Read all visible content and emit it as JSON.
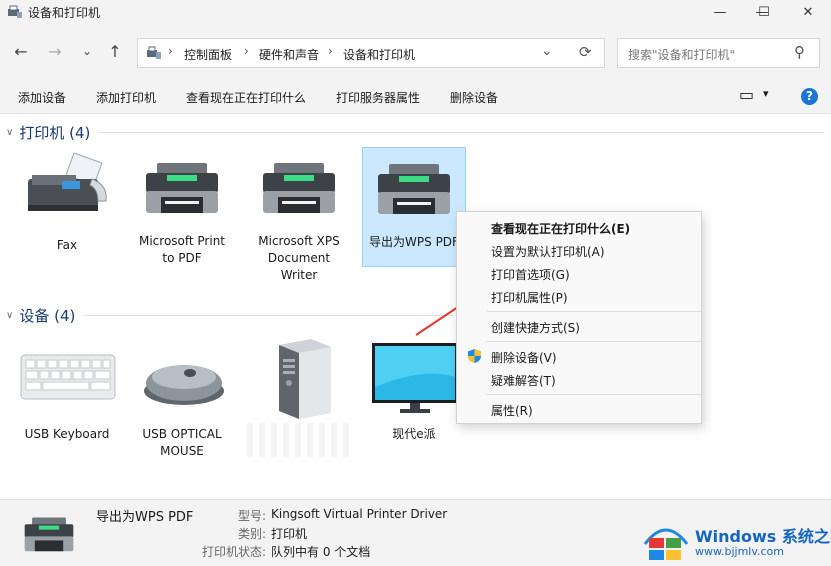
{
  "window": {
    "title": "设备和打印机",
    "minimize_glyph": "—",
    "maximize_glyph": "☐",
    "close_glyph": "✕"
  },
  "nav": {
    "back_glyph": "←",
    "forward_glyph": "→",
    "recent_glyph": "⌄",
    "up_glyph": "↑",
    "breadcrumb": [
      "控制面板",
      "硬件和声音",
      "设备和打印机"
    ],
    "separator_glyph": "›",
    "dropdown_glyph": "⌄",
    "refresh_glyph": "⟳",
    "search_placeholder": "搜索\"设备和打印机\"",
    "search_glyph": "⚲"
  },
  "toolbar": {
    "buttons": [
      "添加设备",
      "添加打印机",
      "查看现在正在打印什么",
      "打印服务器属性",
      "删除设备"
    ],
    "view_glyph": "▭",
    "view_dropdown_glyph": "▾",
    "help_glyph": "?"
  },
  "groups": {
    "printers": {
      "chevron_glyph": "∨",
      "title": "打印机 (4)",
      "items": [
        {
          "name": "Fax",
          "icon": "fax-icon"
        },
        {
          "name": "Microsoft Print to PDF",
          "icon": "printer-icon"
        },
        {
          "name": "Microsoft XPS Document Writer",
          "icon": "printer-icon"
        },
        {
          "name": "导出为WPS PDF",
          "icon": "printer-icon"
        }
      ]
    },
    "devices": {
      "chevron_glyph": "∨",
      "title": "设备 (4)",
      "items": [
        {
          "name": "USB Keyboard",
          "icon": "keyboard-icon"
        },
        {
          "name": "USB OPTICAL MOUSE",
          "icon": "mouse-icon"
        },
        {
          "name": "",
          "icon": "computer-tower-icon"
        },
        {
          "name": "现代e派",
          "icon": "monitor-icon"
        }
      ]
    }
  },
  "context_menu": {
    "items": [
      {
        "label": "查看现在正在打印什么(E)",
        "bold": true
      },
      {
        "label": "设置为默认打印机(A)"
      },
      {
        "label": "打印首选项(G)"
      },
      {
        "label": "打印机属性(P)"
      },
      {
        "label": "创建快捷方式(S)"
      },
      {
        "label": "删除设备(V)",
        "icon": "shield-icon"
      },
      {
        "label": "疑难解答(T)"
      },
      {
        "label": "属性(R)"
      }
    ]
  },
  "details": {
    "name": "导出为WPS PDF",
    "type_key": "型号:",
    "type_value": "Kingsoft Virtual Printer Driver",
    "category_key": "类别:",
    "category_value": "打印机",
    "status_key": "打印机状态:",
    "status_value": "队列中有 0 个文档"
  },
  "watermark": {
    "brand": "Windows 系统之家",
    "url": "www.bjjmlv.com"
  },
  "colors": {
    "accent_blue": "#1a3a6e",
    "selection": "#cce8ff",
    "printer_green": "#3ddc84",
    "arrow_red": "#e53935"
  }
}
